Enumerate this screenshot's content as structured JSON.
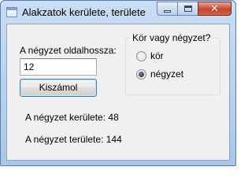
{
  "window": {
    "title": "Alakzatok kerülete, területe"
  },
  "title_buttons": {
    "minimize_glyph": "",
    "maximize_glyph": "",
    "close_glyph": "✕"
  },
  "form": {
    "side_label": "A négyzet oldalhossza:",
    "side_value": "12",
    "calc_button": "Kiszámol",
    "group_title": "Kör vagy négyzet?",
    "options": [
      {
        "label": "kör",
        "checked": false
      },
      {
        "label": "négyzet",
        "checked": true
      }
    ],
    "perimeter_text": "A négyzet kerülete: 48",
    "area_text": "A négyzet területe: 144"
  },
  "icons": {
    "app": "window-app-icon",
    "minimize": "minimize-icon",
    "maximize": "maximize-icon",
    "close": "close-icon",
    "radio": "radio-button-icon"
  },
  "colors": {
    "titlebar": "#b9d1ef",
    "close_button": "#c6452c",
    "client_bg": "#f0f0f0",
    "button_border": "#3c7fb1"
  }
}
